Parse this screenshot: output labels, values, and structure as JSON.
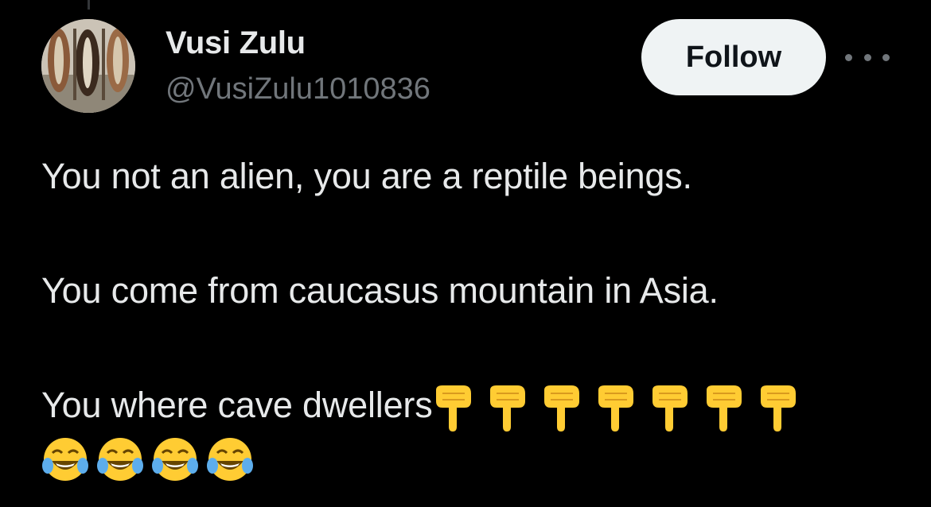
{
  "tweet": {
    "author": {
      "display_name": "Vusi Zulu",
      "handle": "@VusiZulu1010836",
      "avatar_icon": "avatar-image"
    },
    "follow_label": "Follow",
    "more_icon": "more-options-icon",
    "lines": [
      "You not an alien, you are a reptile beings.",
      "You come from caucasus mountain in Asia.",
      "You where cave dwellers"
    ],
    "emojis": {
      "pointing_down_count": 7,
      "pointing_down": "👇",
      "laughing_count": 4,
      "laughing": "😂"
    }
  },
  "colors": {
    "background": "#000000",
    "text": "#e7e9ea",
    "secondary_text": "#71767b",
    "follow_button_bg": "#eff3f4",
    "emoji_yellow": "#ffcc33"
  }
}
